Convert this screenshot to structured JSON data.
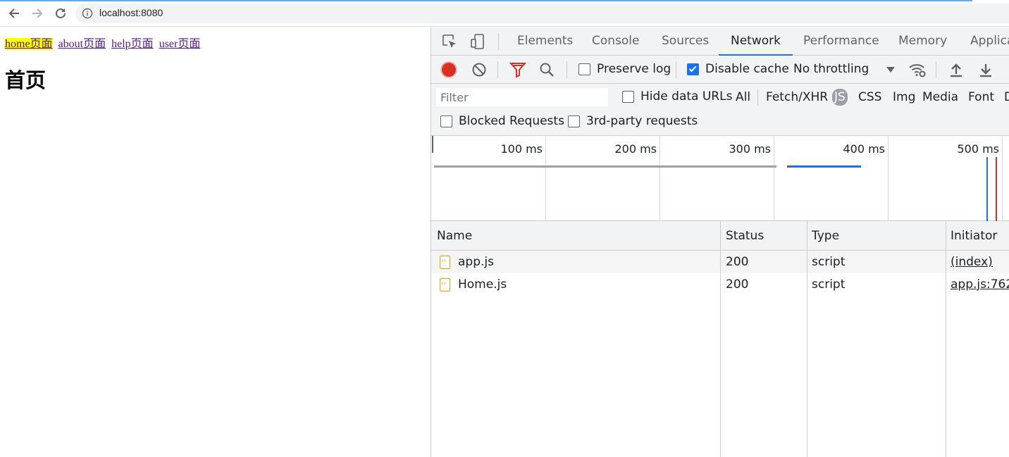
{
  "browser": {
    "url": "localhost:8080",
    "icons": [
      "back-arrow-icon",
      "forward-arrow-icon",
      "reload-icon",
      "info-icon"
    ]
  },
  "page": {
    "links": [
      {
        "label": "home页面",
        "active": true
      },
      {
        "label": "about页面",
        "active": false
      },
      {
        "label": "help页面",
        "active": false
      },
      {
        "label": "user页面",
        "active": false
      }
    ],
    "heading": "首页"
  },
  "devtools": {
    "tabs": [
      "Elements",
      "Console",
      "Sources",
      "Network",
      "Performance",
      "Memory",
      "Applica"
    ],
    "active_tab": "Network",
    "toolbar": {
      "preserve_log": {
        "label": "Preserve log",
        "checked": false
      },
      "disable_cache": {
        "label": "Disable cache",
        "checked": true
      },
      "throttling": "No throttling"
    },
    "filter": {
      "placeholder": "Filter",
      "hide_data_urls": {
        "label": "Hide data URLs",
        "checked": false
      },
      "types": [
        "All",
        "Fetch/XHR",
        "JS",
        "CSS",
        "Img",
        "Media",
        "Font",
        "D"
      ],
      "active_type": "JS",
      "blocked_requests": {
        "label": "Blocked Requests",
        "checked": false
      },
      "third_party": {
        "label": "3rd-party requests",
        "checked": false
      }
    },
    "overview": {
      "ticks": [
        "100 ms",
        "200 ms",
        "300 ms",
        "400 ms",
        "500 ms"
      ]
    },
    "table": {
      "columns": [
        "Name",
        "Status",
        "Type",
        "Initiator"
      ],
      "rows": [
        {
          "name": "app.js",
          "status": "200",
          "type": "script",
          "initiator": "(index)"
        },
        {
          "name": "Home.js",
          "status": "200",
          "type": "script",
          "initiator": "app.js:762"
        }
      ]
    },
    "colors": {
      "accent": "#1a73e8",
      "record": "#d93025",
      "filter_icon": "#d93025",
      "file_icon": "#e8a10a"
    }
  }
}
